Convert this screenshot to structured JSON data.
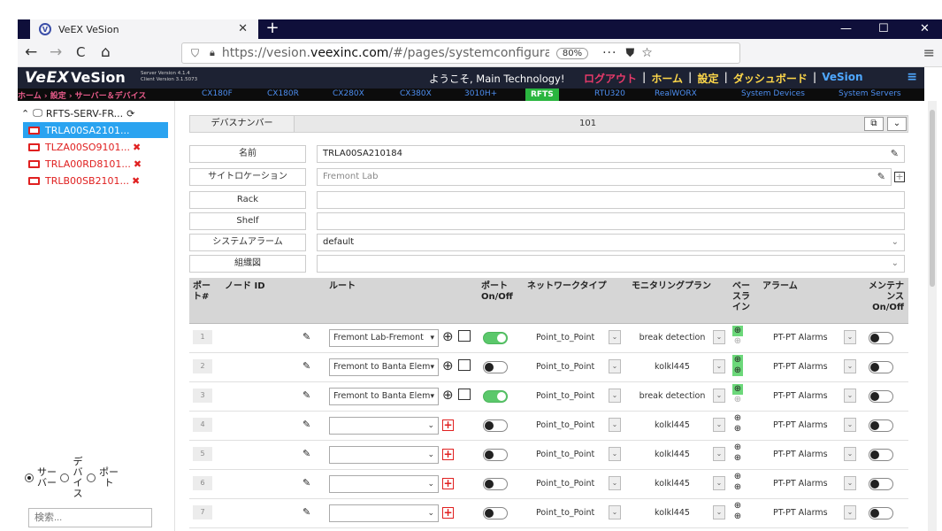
{
  "browser": {
    "tab_title": "VeEX VeSion",
    "tab_close": "✕",
    "new_tab": "+",
    "url_plain": "https://vesion.",
    "url_bold": "veexinc.com",
    "url_rest": "/#/pages/systemconfiguration/sc",
    "zoom": "80%",
    "more": "···",
    "back": "←",
    "forward": "→",
    "reload": "C",
    "home": "⌂",
    "minimize": "—",
    "maximize": "☐",
    "close": "✕"
  },
  "app": {
    "logo": "VeEX",
    "name": "VeSion",
    "server_version": "Server Version 4.1.4",
    "client_version": "Client Version 3.1.5073",
    "welcome": "ようこそ, Main Technology!",
    "links": {
      "logout": "ログアウト",
      "home": "ホーム",
      "settings": "設定",
      "dashboard": "ダッシュボード",
      "vesion": "VeSion"
    },
    "sep": "|",
    "menu": "≡"
  },
  "subnav": {
    "breadcrumb": "ホーム › 設定 › サーバー＆デバイス",
    "items": [
      "CX180F",
      "CX180R",
      "CX280X",
      "CX380X",
      "3010H+",
      "RFTS",
      "RTU320",
      "RealWORX",
      "System Devices",
      "System Servers"
    ],
    "active": "RFTS"
  },
  "sidebar": {
    "root": "RFTS-SERV-FR...",
    "devices": [
      {
        "label": "TRLA00SA2101...",
        "selected": true,
        "error": false
      },
      {
        "label": "TLZA00SO9101...",
        "selected": false,
        "error": true
      },
      {
        "label": "TRLA00RD8101...",
        "selected": false,
        "error": true
      },
      {
        "label": "TRLB00SB2101...",
        "selected": false,
        "error": true
      }
    ],
    "err_mark": "✖",
    "radio_server": "サーバー",
    "radio_device": "デバイス",
    "radio_port": "ポート",
    "search_placeholder": "検索..."
  },
  "form": {
    "device_number_label": "デバスナンバー",
    "device_number": "101",
    "name_label": "名前",
    "name_value": "TRLA00SA210184",
    "site_label": "サイトロケーション",
    "site_value": "Fremont Lab",
    "rack_label": "Rack",
    "rack_value": "",
    "shelf_label": "Shelf",
    "shelf_value": "",
    "alarm_label": "システムアラーム",
    "alarm_value": "default",
    "org_label": "組織図",
    "org_value": ""
  },
  "table": {
    "headers": {
      "port": "ポート#",
      "node": "ノード ID",
      "route": "ルート",
      "onoff": "ポート On/Off",
      "network": "ネットワークタイプ",
      "plan": "モニタリングプラン",
      "baseline": "ベースライン",
      "alarm": "アラーム",
      "maint": "メンテナンス On/Off"
    },
    "rows": [
      {
        "port": "1",
        "route": "Fremont Lab-Fremont",
        "on": true,
        "network": "Point_to_Point",
        "plan": "break detection",
        "baseline": "g",
        "alarm": "PT-PT Alarms"
      },
      {
        "port": "2",
        "route": "Fremont to Banta Elem",
        "on": false,
        "network": "Point_to_Point",
        "plan": "kolkl445",
        "baseline": "gg",
        "alarm": "PT-PT Alarms"
      },
      {
        "port": "3",
        "route": "Fremont to Banta Elem",
        "on": true,
        "network": "Point_to_Point",
        "plan": "break detection",
        "baseline": "g",
        "alarm": "PT-PT Alarms"
      },
      {
        "port": "4",
        "route": "",
        "on": false,
        "network": "Point_to_Point",
        "plan": "kolkl445",
        "baseline": "n",
        "alarm": "PT-PT Alarms"
      },
      {
        "port": "5",
        "route": "",
        "on": false,
        "network": "Point_to_Point",
        "plan": "kolkl445",
        "baseline": "n",
        "alarm": "PT-PT Alarms"
      },
      {
        "port": "6",
        "route": "",
        "on": false,
        "network": "Point_to_Point",
        "plan": "kolkl445",
        "baseline": "n",
        "alarm": "PT-PT Alarms"
      },
      {
        "port": "7",
        "route": "",
        "on": false,
        "network": "Point_to_Point",
        "plan": "kolkl445",
        "baseline": "n",
        "alarm": "PT-PT Alarms"
      }
    ]
  },
  "colors": {
    "accent_blue": "#2aa3f0",
    "error_red": "#e02020",
    "toggle_green": "#5bc86b",
    "header_bg": "#1d2233"
  }
}
